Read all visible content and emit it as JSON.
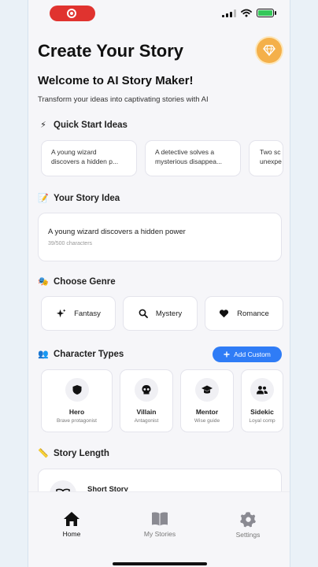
{
  "header": {
    "title": "Create Your Story",
    "welcome": "Welcome to AI Story Maker!",
    "subtitle": "Transform your ideas into captivating stories with AI"
  },
  "quick_start": {
    "emoji": "⚡",
    "heading": "Quick Start Ideas",
    "items": [
      {
        "line1": "A young wizard",
        "line2": "discovers a hidden p..."
      },
      {
        "line1": "A detective solves a",
        "line2": "mysterious disappea..."
      },
      {
        "line1": "Two sc",
        "line2": "unexpe"
      }
    ]
  },
  "story_idea": {
    "emoji": "📝",
    "heading": "Your Story Idea",
    "value": "A young wizard discovers a hidden power",
    "char_count": "39/500 characters"
  },
  "genre": {
    "emoji": "🎭",
    "heading": "Choose Genre",
    "items": [
      {
        "label": "Fantasy",
        "icon": "sparkles-icon"
      },
      {
        "label": "Mystery",
        "icon": "search-icon"
      },
      {
        "label": "Romance",
        "icon": "heart-icon"
      }
    ]
  },
  "characters": {
    "emoji": "👥",
    "heading": "Character Types",
    "add_label": "Add Custom",
    "items": [
      {
        "name": "Hero",
        "desc": "Brave protagonist",
        "icon": "shield-icon"
      },
      {
        "name": "Villain",
        "desc": "Antagonist",
        "icon": "skull-icon"
      },
      {
        "name": "Mentor",
        "desc": "Wise guide",
        "icon": "graduation-cap-icon"
      },
      {
        "name": "Sidekic",
        "desc": "Loyal comp",
        "icon": "people-icon"
      }
    ]
  },
  "story_length": {
    "emoji": "📏",
    "heading": "Story Length",
    "option": "Short Story"
  },
  "tabs": [
    {
      "label": "Home",
      "icon": "home-icon",
      "active": true
    },
    {
      "label": "My Stories",
      "icon": "book-icon",
      "active": false
    },
    {
      "label": "Settings",
      "icon": "gear-icon",
      "active": false
    }
  ],
  "colors": {
    "accent": "#2f7cf6",
    "record": "#e0332f",
    "avatar": "#f4b04a",
    "battery": "#34c759"
  }
}
